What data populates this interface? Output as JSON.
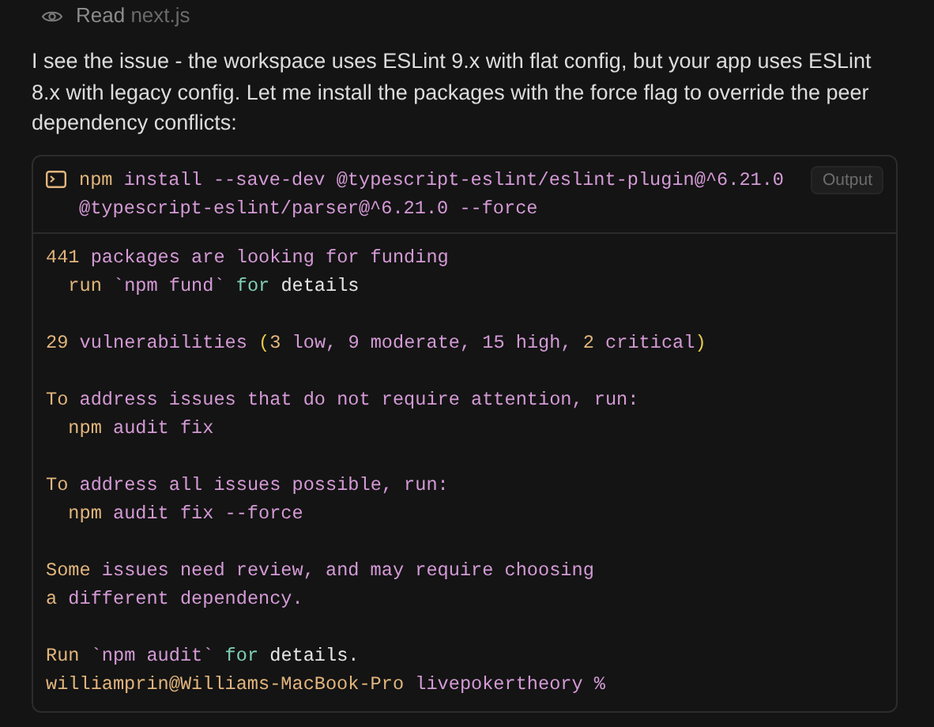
{
  "read_step": {
    "action": "Read",
    "file": "next.js"
  },
  "message": "I see the issue - the workspace uses ESLint 9.x with flat config, but your app uses ESLint 8.x with legacy config. Let me install the packages with the force flag to override the peer dependency conflicts:",
  "terminal": {
    "command": [
      {
        "kind": "lead",
        "text": "npm"
      },
      {
        "kind": "text",
        "text": " install --save-dev @typescript-eslint/eslint-plugin@^6.21.0 @typescript-eslint/parser@^6.21.0 --force"
      }
    ],
    "badge": "Output",
    "lines": [
      {
        "kind": "output",
        "segments": [
          {
            "kind": "lead",
            "text": "441"
          },
          {
            "kind": "text",
            "text": " packages are looking for funding"
          }
        ]
      },
      {
        "kind": "output",
        "segments": [
          {
            "kind": "lead",
            "text": "  run"
          },
          {
            "kind": "text",
            "text": " `npm fund` "
          },
          {
            "kind": "keyword",
            "text": "for"
          },
          {
            "kind": "plain",
            "text": " details"
          }
        ]
      },
      {
        "kind": "blank"
      },
      {
        "kind": "output",
        "segments": [
          {
            "kind": "lead",
            "text": "29"
          },
          {
            "kind": "text",
            "text": " vulnerabilities "
          },
          {
            "kind": "paren",
            "text": "("
          },
          {
            "kind": "lead",
            "text": "3"
          },
          {
            "kind": "text",
            "text": " low, 9 moderate, 15 high, "
          },
          {
            "kind": "lead",
            "text": "2"
          },
          {
            "kind": "text",
            "text": " critical"
          },
          {
            "kind": "paren",
            "text": ")"
          }
        ]
      },
      {
        "kind": "blank"
      },
      {
        "kind": "output",
        "segments": [
          {
            "kind": "lead",
            "text": "To"
          },
          {
            "kind": "text",
            "text": " address issues that do not require attention, run:"
          }
        ]
      },
      {
        "kind": "output",
        "segments": [
          {
            "kind": "lead",
            "text": "  npm"
          },
          {
            "kind": "text",
            "text": " audit fix"
          }
        ]
      },
      {
        "kind": "blank"
      },
      {
        "kind": "output",
        "segments": [
          {
            "kind": "lead",
            "text": "To"
          },
          {
            "kind": "text",
            "text": " address all issues possible, run:"
          }
        ]
      },
      {
        "kind": "output",
        "segments": [
          {
            "kind": "lead",
            "text": "  npm"
          },
          {
            "kind": "text",
            "text": " audit fix --force"
          }
        ]
      },
      {
        "kind": "blank"
      },
      {
        "kind": "output",
        "segments": [
          {
            "kind": "lead",
            "text": "Some"
          },
          {
            "kind": "text",
            "text": " issues need review, and may require choosing"
          }
        ]
      },
      {
        "kind": "output",
        "segments": [
          {
            "kind": "lead",
            "text": "a"
          },
          {
            "kind": "text",
            "text": " different dependency."
          }
        ]
      },
      {
        "kind": "blank"
      },
      {
        "kind": "output",
        "segments": [
          {
            "kind": "lead",
            "text": "Run"
          },
          {
            "kind": "text",
            "text": " `npm audit` "
          },
          {
            "kind": "keyword",
            "text": "for"
          },
          {
            "kind": "plain",
            "text": " details."
          }
        ]
      },
      {
        "kind": "output",
        "segments": [
          {
            "kind": "lead",
            "text": "williamprin@Williams-MacBook-Pro"
          },
          {
            "kind": "text",
            "text": " livepokertheory %"
          }
        ]
      }
    ]
  }
}
